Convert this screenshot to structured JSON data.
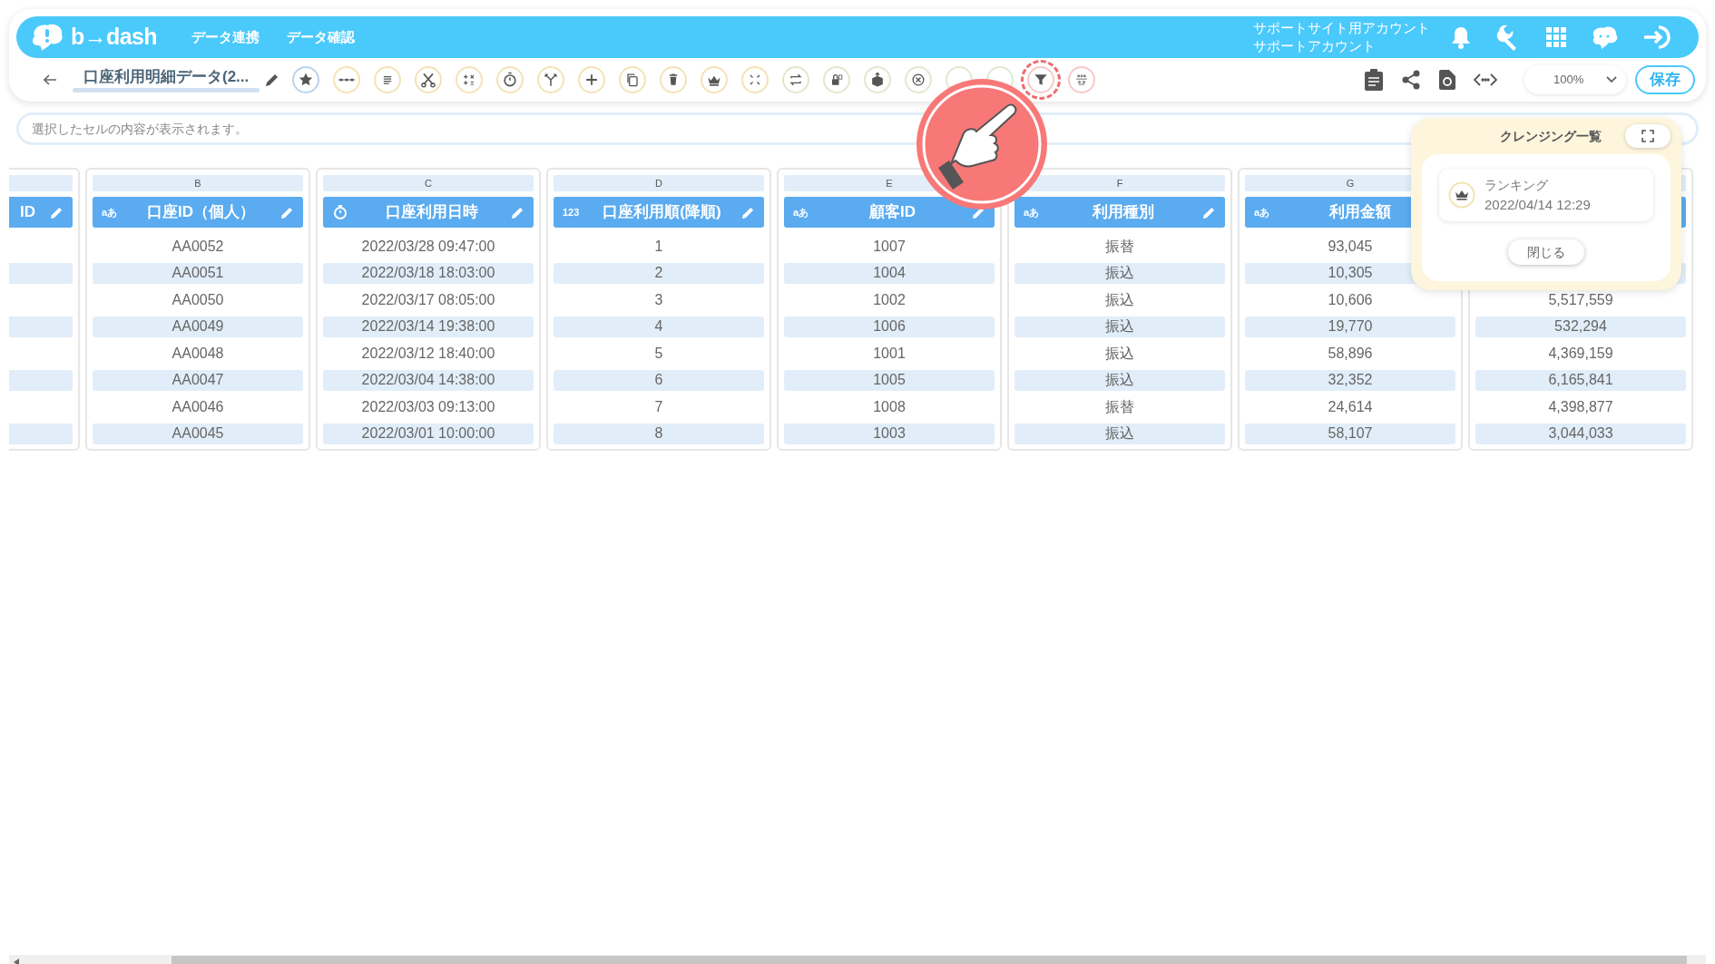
{
  "header": {
    "logo": "b→dash",
    "nav": [
      "データ連携",
      "データ確認"
    ],
    "account": [
      "サポートサイト用アカウント",
      "サポートアカウント"
    ]
  },
  "toolbar": {
    "title": "口座利用明細データ(2...",
    "tools": [
      {
        "kind": "star",
        "color": "#b9d3ec",
        "highlighted": false
      },
      {
        "kind": "dots",
        "color": "#f3e3b5",
        "highlighted": false
      },
      {
        "kind": "lines",
        "color": "#f3e3b5",
        "highlighted": false
      },
      {
        "kind": "scissors",
        "color": "#f3e3b5",
        "highlighted": false
      },
      {
        "kind": "calc",
        "color": "#f3e3b5",
        "highlighted": false
      },
      {
        "kind": "timer",
        "color": "#f3e3b5",
        "highlighted": false
      },
      {
        "kind": "merge",
        "color": "#f3e3b5",
        "highlighted": false
      },
      {
        "kind": "plus",
        "color": "#f3e3b5",
        "highlighted": false
      },
      {
        "kind": "copy",
        "color": "#f3e3b5",
        "highlighted": false
      },
      {
        "kind": "trash",
        "color": "#f3e3b5",
        "highlighted": false
      },
      {
        "kind": "crown",
        "color": "#f3e3b5",
        "highlighted": false
      },
      {
        "kind": "shrink",
        "color": "#f3e3b5",
        "highlighted": false
      },
      {
        "kind": "swap",
        "color": "#dfe9cf",
        "highlighted": false
      },
      {
        "kind": "lock",
        "color": "#dfe9cf",
        "highlighted": false
      },
      {
        "kind": "box",
        "color": "#dfe9cf",
        "highlighted": false
      },
      {
        "kind": "cancel",
        "color": "#dfe9cf",
        "highlighted": false
      },
      {
        "kind": "blank",
        "color": "#dfe9cf",
        "highlighted": false
      },
      {
        "kind": "blank",
        "color": "#dfe9cf",
        "highlighted": false
      },
      {
        "kind": "funnel",
        "color": "#f7c9c9",
        "highlighted": true
      },
      {
        "kind": "grid",
        "color": "#f7c9c9",
        "highlighted": false
      }
    ],
    "zoom": "100%",
    "save": "保存"
  },
  "formula_bar": {
    "placeholder": "選択したセルの内容が表示されます。"
  },
  "columns": [
    {
      "partial": true,
      "kind": "text",
      "name": "ID",
      "cells": [
        "",
        "",
        "",
        "",
        "",
        "",
        "",
        ""
      ]
    },
    {
      "letter": "B",
      "kind": "text",
      "type_label": "aあ",
      "name": "口座ID（個人）",
      "cells": [
        "AA0052",
        "AA0051",
        "AA0050",
        "AA0049",
        "AA0048",
        "AA0047",
        "AA0046",
        "AA0045"
      ]
    },
    {
      "letter": "C",
      "kind": "time",
      "name": "口座利用日時",
      "cells": [
        "2022/03/28 09:47:00",
        "2022/03/18 18:03:00",
        "2022/03/17 08:05:00",
        "2022/03/14 19:38:00",
        "2022/03/12 18:40:00",
        "2022/03/04 14:38:00",
        "2022/03/03 09:13:00",
        "2022/03/01 10:00:00"
      ]
    },
    {
      "letter": "D",
      "kind": "number",
      "type_label": "123",
      "name": "口座利用順(降順)",
      "cells": [
        "1",
        "2",
        "3",
        "4",
        "5",
        "6",
        "7",
        "8"
      ]
    },
    {
      "letter": "E",
      "kind": "text",
      "type_label": "aあ",
      "name": "顧客ID",
      "cells": [
        "1007",
        "1004",
        "1002",
        "1006",
        "1001",
        "1005",
        "1008",
        "1003"
      ]
    },
    {
      "letter": "F",
      "kind": "text",
      "type_label": "aあ",
      "name": "利用種別",
      "cells": [
        "振替",
        "振込",
        "振込",
        "振込",
        "振込",
        "振込",
        "振替",
        "振込"
      ]
    },
    {
      "letter": "G",
      "kind": "text",
      "type_label": "aあ",
      "covered": true,
      "name": "利用金額",
      "cells": [
        "93,045",
        "10,305",
        "10,606",
        "19,770",
        "58,896",
        "32,352",
        "24,614",
        "58,107"
      ]
    },
    {
      "kind": "none",
      "cells": [
        "",
        "",
        "5,517,559",
        "532,294",
        "4,369,159",
        "6,165,841",
        "4,398,877",
        "3,044,033"
      ]
    }
  ],
  "cleansing_panel": {
    "title": "クレンジング一覧",
    "items": [
      {
        "name": "ランキング",
        "date": "2022/04/14 12:29"
      }
    ],
    "close": "閉じる"
  }
}
